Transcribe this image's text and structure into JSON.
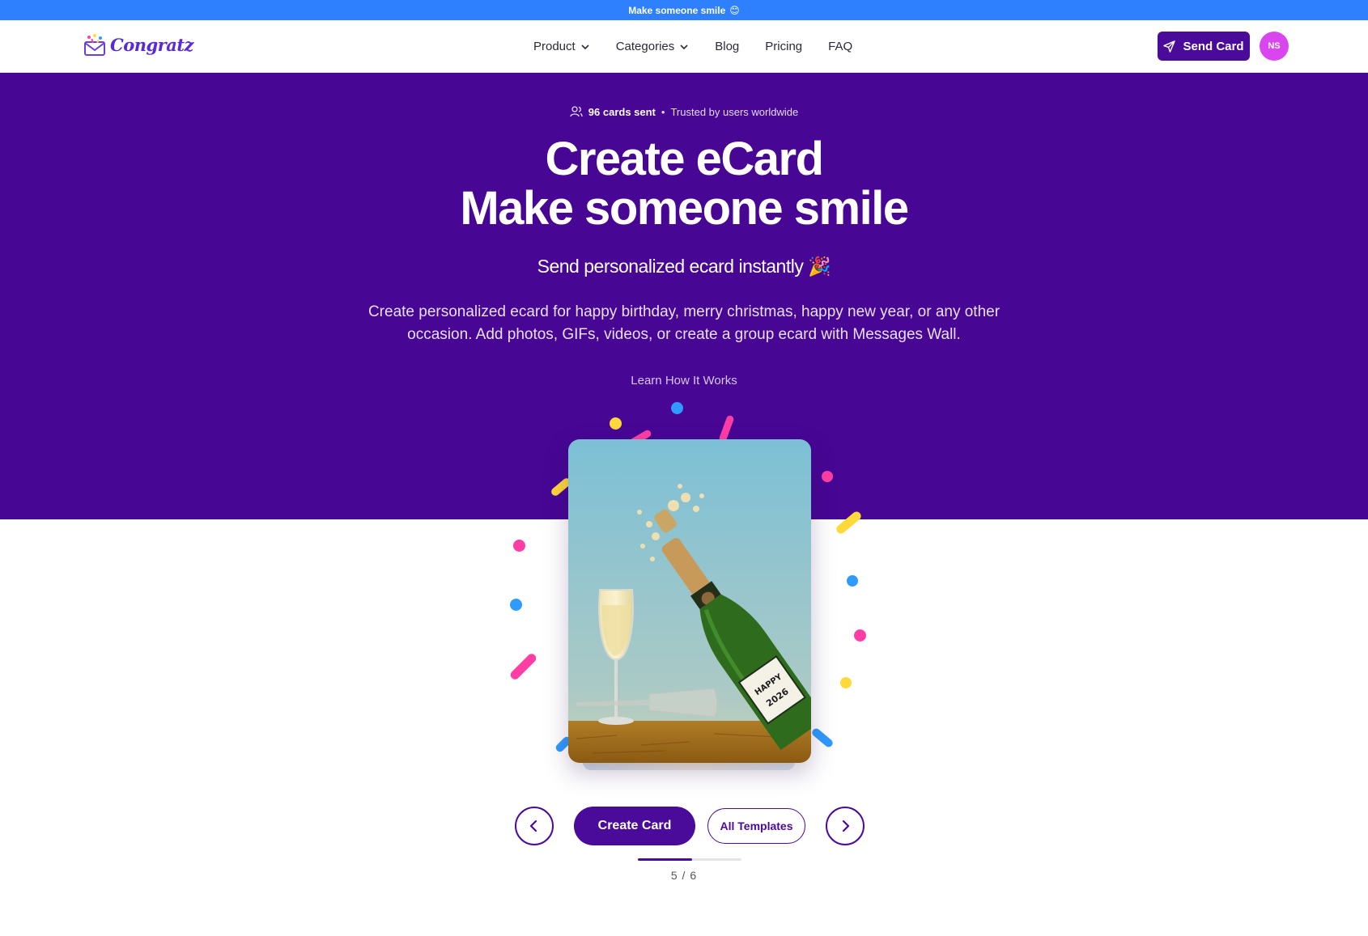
{
  "announcement": {
    "text": "Make someone smile",
    "emoji": "😊"
  },
  "brand": {
    "name": "Congratz"
  },
  "nav": {
    "items": [
      {
        "label": "Product",
        "dropdown": true
      },
      {
        "label": "Categories",
        "dropdown": true
      },
      {
        "label": "Blog",
        "dropdown": false
      },
      {
        "label": "Pricing",
        "dropdown": false
      },
      {
        "label": "FAQ",
        "dropdown": false
      }
    ],
    "send_button": "Send Card",
    "avatar_initials": "NS"
  },
  "hero": {
    "stat_count": "96 cards sent",
    "stat_separator": "•",
    "stat_trust": "Trusted by users worldwide",
    "title_line1": "Create eCard",
    "title_line2": "Make someone smile",
    "subtitle": "Send personalized ecard instantly",
    "subtitle_emoji": "🎉",
    "description": "Create personalized ecard for happy birthday, merry christmas, happy new year, or any other occasion. Add photos, GIFs, videos, or create a group ecard with Messages Wall.",
    "learn_link": "Learn How It Works"
  },
  "card_preview": {
    "label_line1": "HAPPY",
    "label_line2": "2026"
  },
  "carousel": {
    "create_button": "Create Card",
    "templates_button": "All Templates",
    "counter": "5 / 6",
    "current": 5,
    "total": 6,
    "progress_fraction": 0.52
  },
  "colors": {
    "announcement_bg": "#2f80ff",
    "hero_bg": "#470694",
    "primary": "#4a0a9a",
    "avatar_bg": "#d946ef",
    "confetti_pink": "#ff3ea5",
    "confetti_blue": "#2f9bff",
    "confetti_yellow": "#ffd83a"
  }
}
